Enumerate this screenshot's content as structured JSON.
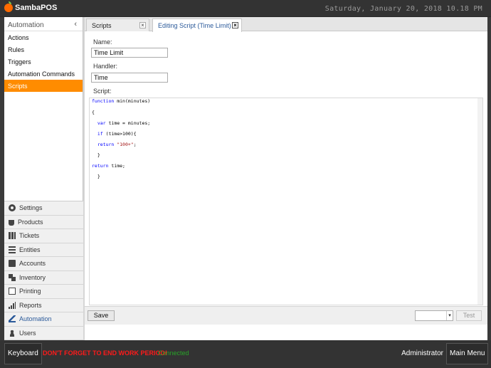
{
  "app": {
    "name": "SambaPOS",
    "datetime": "Saturday, January 20, 2018 10.18 PM"
  },
  "sidebar": {
    "header": "Automation",
    "collapse_icon": "chevron-left-icon",
    "items": [
      {
        "label": "Actions"
      },
      {
        "label": "Rules"
      },
      {
        "label": "Triggers"
      },
      {
        "label": "Automation Commands"
      },
      {
        "label": "Scripts",
        "selected": true
      }
    ],
    "nav": [
      {
        "label": "Settings",
        "icon": "gear-icon"
      },
      {
        "label": "Products",
        "icon": "cup-icon"
      },
      {
        "label": "Tickets",
        "icon": "books-icon"
      },
      {
        "label": "Entities",
        "icon": "list-icon"
      },
      {
        "label": "Accounts",
        "icon": "calculator-icon"
      },
      {
        "label": "Inventory",
        "icon": "inventory-icon"
      },
      {
        "label": "Printing",
        "icon": "document-icon"
      },
      {
        "label": "Reports",
        "icon": "bar-chart-icon"
      },
      {
        "label": "Automation",
        "icon": "pen-icon",
        "active": true
      },
      {
        "label": "Users",
        "icon": "user-icon"
      }
    ],
    "accent_color": "#ff8c00"
  },
  "tabs": [
    {
      "label": "Scripts",
      "close": "×"
    },
    {
      "label": "Editing Script (Time Limit)",
      "close": "×",
      "active": true
    }
  ],
  "form": {
    "name_label": "Name:",
    "name_value": "Time Limit",
    "handler_label": "Handler:",
    "handler_value": "Time",
    "script_label": "Script:"
  },
  "script_lines": {
    "l1": "function min(minutes)",
    "l2": "{",
    "l3": "  var time = minutes;",
    "l4": "  if (time>100){",
    "l5": "  return \"100+\";",
    "l6": "  }",
    "l7": "return time;",
    "l8": "  }"
  },
  "footer": {
    "save_label": "Save",
    "combo_arrow": "▾",
    "test_label": "Test"
  },
  "bottombar": {
    "keyboard_label": "Keyboard",
    "warning": "DON'T FORGET TO END WORK PERIOD!",
    "status": "Connected",
    "user": "Administrator",
    "main_menu_label": "Main Menu",
    "warning_color": "#ff1a1a",
    "status_color": "#28a428"
  }
}
